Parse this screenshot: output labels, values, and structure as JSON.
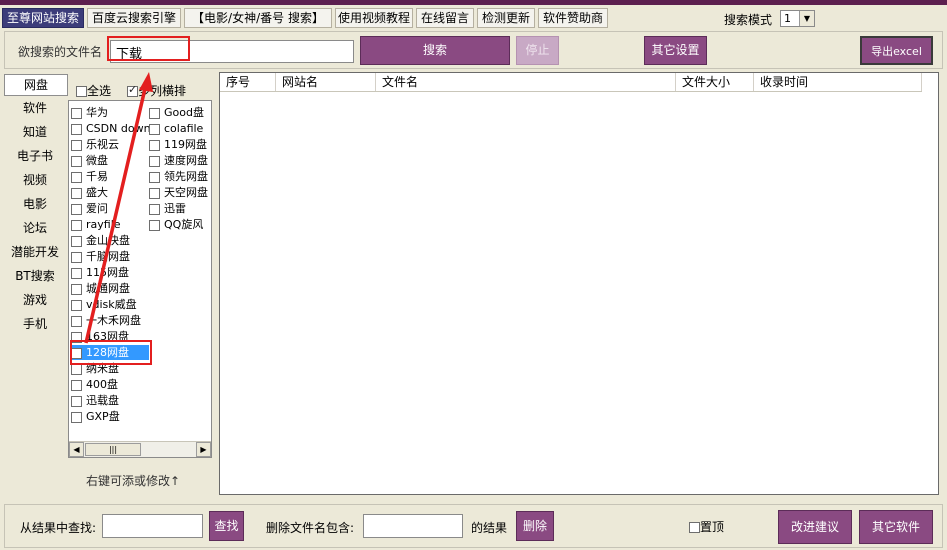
{
  "tabs": [
    "至尊网站搜索",
    "百度云搜索引擎",
    "【电影/女神/番号 搜索】",
    "使用视频教程",
    "在线留言",
    "检测更新",
    "软件赞助商"
  ],
  "search_mode": {
    "label": "搜索模式",
    "value": "1"
  },
  "search_row": {
    "label": "欲搜索的文件名",
    "value": "下载",
    "search_btn": "搜索",
    "stop_btn": "停止",
    "settings_btn": "其它设置",
    "export_btn": "导出excel"
  },
  "categories": [
    "网盘",
    "软件",
    "知道",
    "电子书",
    "视频",
    "电影",
    "论坛",
    "潜能开发",
    "BT搜索",
    "游戏",
    "手机"
  ],
  "select_all": "全选",
  "multi_col": "多列横排",
  "col1": [
    "华为",
    "CSDN down",
    "乐视云",
    "微盘",
    "千易",
    "盛大",
    "爱问",
    "rayfile",
    "金山快盘",
    "千脑网盘",
    "115网盘",
    "城通网盘",
    "vdisk威盘",
    "一木禾网盘",
    "163网盘",
    "128网盘",
    "纳米盘",
    "400盘",
    "迅载盘",
    "GXP盘"
  ],
  "col2": [
    "Good盘",
    "colafile",
    "119网盘",
    "速度网盘",
    "领先网盘",
    "天空网盘",
    "迅雷",
    "QQ旋风"
  ],
  "hint": "右键可添或修改↑",
  "columns": [
    "序号",
    "网站名",
    "文件名",
    "文件大小",
    "收录时间"
  ],
  "bottom": {
    "find_label": "从结果中查找:",
    "find_btn": "查找",
    "delete_label": "删除文件名包含:",
    "result_label": "的结果",
    "delete_btn": "删除",
    "top_label": "置顶",
    "improve_btn": "改进建议",
    "other_btn": "其它软件"
  }
}
